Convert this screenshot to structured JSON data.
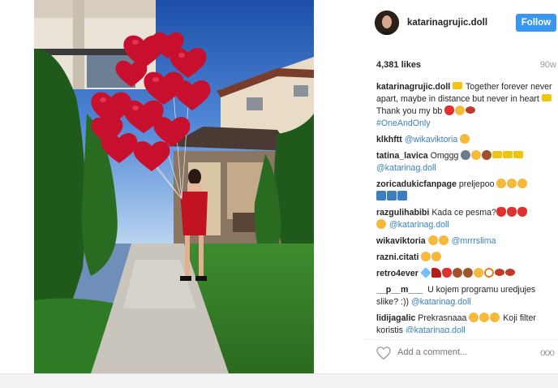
{
  "post": {
    "photo_alt": "",
    "header": {
      "username": "katarinagrujic.doll",
      "follow_label": "Follow"
    },
    "stats": {
      "likes": "4,381 likes",
      "age": "90w"
    },
    "comments": [
      {
        "user": "katarinagrujic.doll",
        "parts": [
          {
            "e": "gold"
          },
          {
            "t": " Together forever never apart, maybe in distance but never in heart "
          },
          {
            "e": "gold"
          },
          {
            "br": 1
          },
          {
            "t": "Thank you my bb "
          },
          {
            "e": "red"
          },
          {
            "e": ""
          },
          {
            "e": "lips"
          },
          {
            "br": 1
          },
          {
            "h": "#OneAndOnly"
          }
        ]
      },
      {
        "user": "klkhftt",
        "parts": [
          {
            "m": "@wikaviktoria"
          },
          {
            "t": " "
          },
          {
            "e": ""
          }
        ]
      },
      {
        "user": "tatina_lavica",
        "parts": [
          {
            "t": "Omggg "
          },
          {
            "e": "gray"
          },
          {
            "e": ""
          },
          {
            "e": "brown"
          },
          {
            "e": "gold"
          },
          {
            "e": "gold"
          },
          {
            "e": "gold"
          },
          {
            "br": 1
          },
          {
            "m": "@katarinag.doll"
          }
        ]
      },
      {
        "user": "zoricadukicfanpage",
        "parts": [
          {
            "t": "preljepoo "
          },
          {
            "e": ""
          },
          {
            "e": ""
          },
          {
            "e": ""
          },
          {
            "br": 1
          },
          {
            "e": "blue"
          },
          {
            "e": "blue"
          },
          {
            "e": "blue"
          }
        ]
      },
      {
        "user": "razgulihabibi",
        "parts": [
          {
            "t": "Kada ce pesma?"
          },
          {
            "e": "red"
          },
          {
            "e": "red"
          },
          {
            "e": "red"
          },
          {
            "br": 1
          },
          {
            "e": ""
          },
          {
            "t": " "
          },
          {
            "m": "@katarinag.doll"
          }
        ]
      },
      {
        "user": "wikaviktoria",
        "parts": [
          {
            "e": ""
          },
          {
            "e": ""
          },
          {
            "t": " "
          },
          {
            "m": "@mrrrslima"
          }
        ]
      },
      {
        "user": "razni.citati",
        "parts": [
          {
            "e": ""
          },
          {
            "e": ""
          }
        ]
      },
      {
        "user": "retro4ever",
        "parts": [
          {
            "e": "dia"
          },
          {
            "e": "heel"
          },
          {
            "e": "red"
          },
          {
            "e": "brown"
          },
          {
            "e": "brown"
          },
          {
            "e": ""
          },
          {
            "e": "ring"
          },
          {
            "e": "lips"
          },
          {
            "e": "lips"
          }
        ]
      },
      {
        "user": "__p__m___",
        "parts": [
          {
            "t": " U kojem programu uredjujes slike? :)) "
          },
          {
            "m": "@katarinag.doll"
          }
        ]
      },
      {
        "user": "lidijagalic",
        "parts": [
          {
            "t": "Prekrasnaaa "
          },
          {
            "e": ""
          },
          {
            "e": ""
          },
          {
            "e": ""
          },
          {
            "t": " Koji filter koristis "
          },
          {
            "m": "@katarinag.doll"
          }
        ]
      }
    ],
    "add_comment_placeholder": "Add a comment...",
    "more_label": "ooo",
    "icons": [
      "heart-icon",
      "more-options-icon"
    ],
    "colors": {
      "follow": "#3897f0",
      "link": "#3a7fbf"
    }
  }
}
